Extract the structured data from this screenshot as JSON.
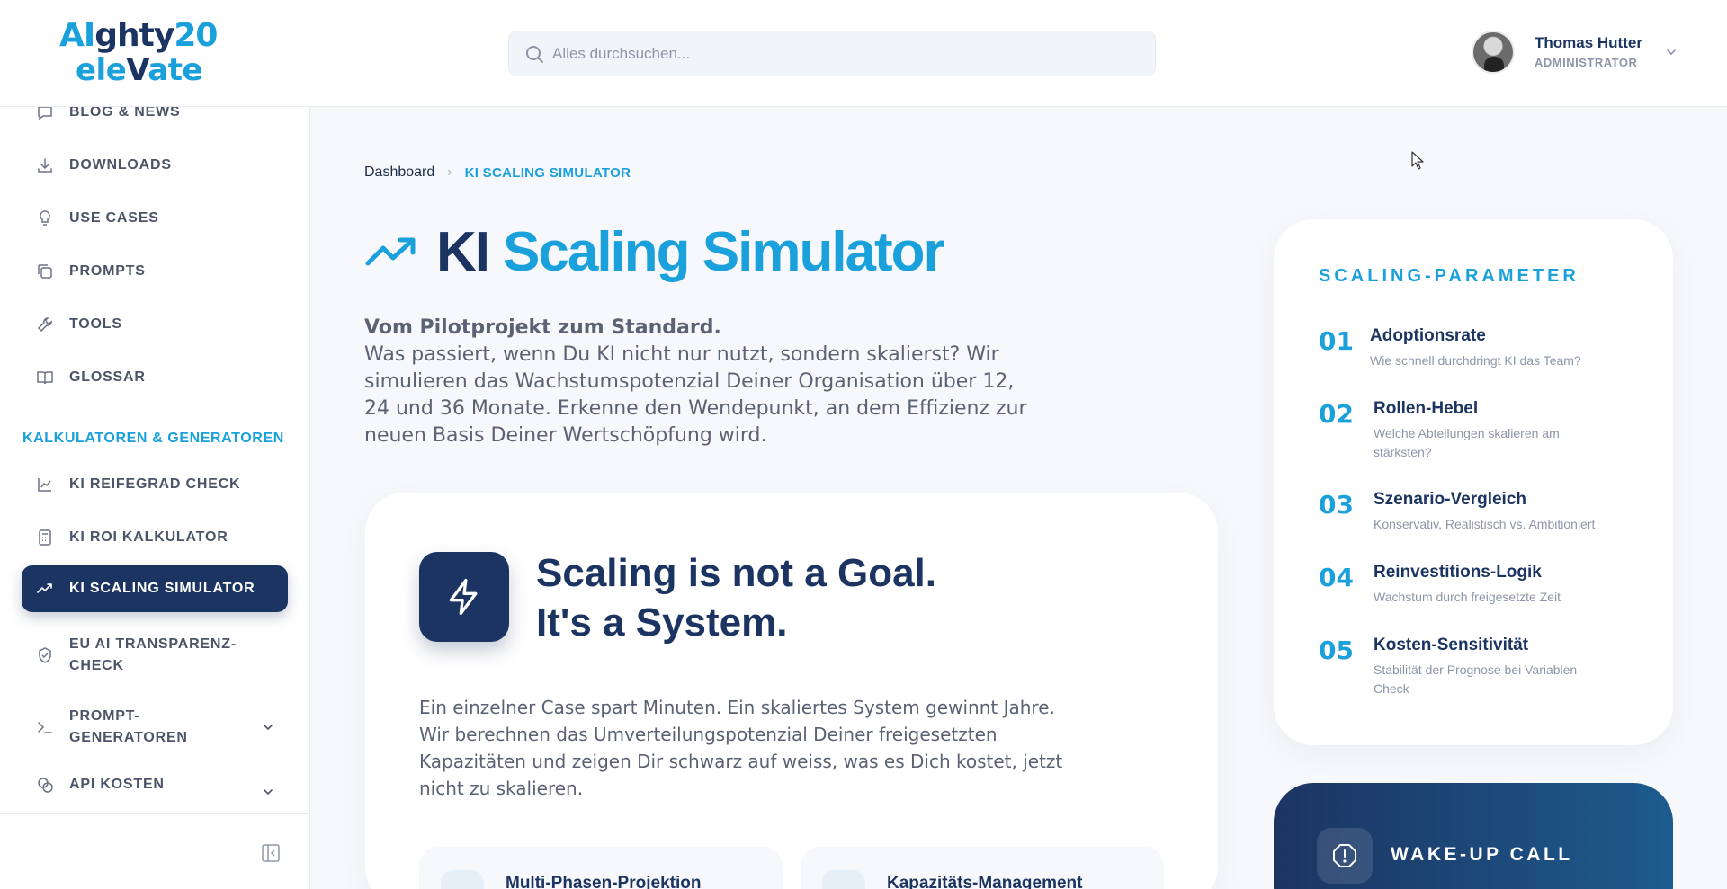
{
  "header": {
    "logo_line1_a": "AI",
    "logo_line1_b": "ghty",
    "logo_line1_c": "20",
    "logo_line2_a": "ele",
    "logo_line2_b": "V",
    "logo_line2_c": "ate",
    "search_placeholder": "Alles durchsuchen...",
    "user_name": "Thomas Hutter",
    "user_role": "ADMINISTRATOR"
  },
  "sidebar": {
    "items_top": [
      {
        "label": "BLOG & NEWS",
        "icon": "chat-bubble-icon"
      },
      {
        "label": "DOWNLOADS",
        "icon": "download-icon"
      },
      {
        "label": "USE CASES",
        "icon": "lightbulb-icon"
      },
      {
        "label": "PROMPTS",
        "icon": "copy-icon"
      },
      {
        "label": "TOOLS",
        "icon": "wrench-icon"
      },
      {
        "label": "GLOSSAR",
        "icon": "book-icon"
      }
    ],
    "section_title": "KALKULATOREN & GENERATOREN",
    "items_calc": [
      {
        "label": "KI REIFEGRAD CHECK",
        "icon": "line-chart-icon"
      },
      {
        "label": "KI ROI KALKULATOR",
        "icon": "calculator-icon"
      },
      {
        "label": "KI SCALING SIMULATOR",
        "icon": "trend-up-icon",
        "active": true
      },
      {
        "label_1": "EU AI TRANSPARENZ-",
        "label_2": "CHECK",
        "icon": "shield-check-icon"
      },
      {
        "label_1": "PROMPT-",
        "label_2": "GENERATOREN",
        "icon": "terminal-icon"
      },
      {
        "label": "API KOSTEN",
        "icon": "coins-icon"
      }
    ]
  },
  "breadcrumb": {
    "home": "Dashboard",
    "separator": "›",
    "current": "KI SCALING SIMULATOR"
  },
  "page": {
    "title_part1": "KI",
    "title_part2": "Scaling Simulator",
    "intro_lead": "Vom Pilotprojekt zum Standard.",
    "intro_text": "Was passiert, wenn Du KI nicht nur nutzt, sondern skalierst? Wir simulieren das Wachstumspotenzial Deiner Organisation über 12, 24 und 36 Monate. Erkenne den Wendepunkt, an dem Effizienz zur neuen Basis Deiner Wertschöpfung wird."
  },
  "main_card": {
    "heading_line1": "Scaling is not a Goal.",
    "heading_line2": "It's a System.",
    "text": "Ein einzelner Case spart Minuten. Ein skaliertes System gewinnt Jahre. Wir berechnen das Umverteilungspotenzial Deiner freigesetzten Kapazitäten und zeigen Dir schwarz auf weiss, was es Dich kostet, jetzt nicht zu skalieren.",
    "feature1": "Multi-Phasen-Projektion",
    "feature2": "Kapazitäts-Management"
  },
  "params": {
    "title": "SCALING-PARAMETER",
    "items": [
      {
        "num": "01",
        "title": "Adoptionsrate",
        "desc": "Wie schnell durchdringt KI das Team?"
      },
      {
        "num": "02",
        "title": "Rollen-Hebel",
        "desc": "Welche Abteilungen skalieren am stärksten?"
      },
      {
        "num": "03",
        "title": "Szenario-Vergleich",
        "desc": "Konservativ, Realistisch vs. Ambitioniert"
      },
      {
        "num": "04",
        "title": "Reinvestitions-Logik",
        "desc": "Wachstum durch freigesetzte Zeit"
      },
      {
        "num": "05",
        "title": "Kosten-Sensitivität",
        "desc": "Stabilität der Prognose bei Variablen-Check"
      }
    ]
  },
  "wake_up": {
    "label": "WAKE-UP CALL"
  },
  "colors": {
    "navy": "#1c3461",
    "accent": "#1aa0da",
    "muted": "#8d96a6"
  }
}
